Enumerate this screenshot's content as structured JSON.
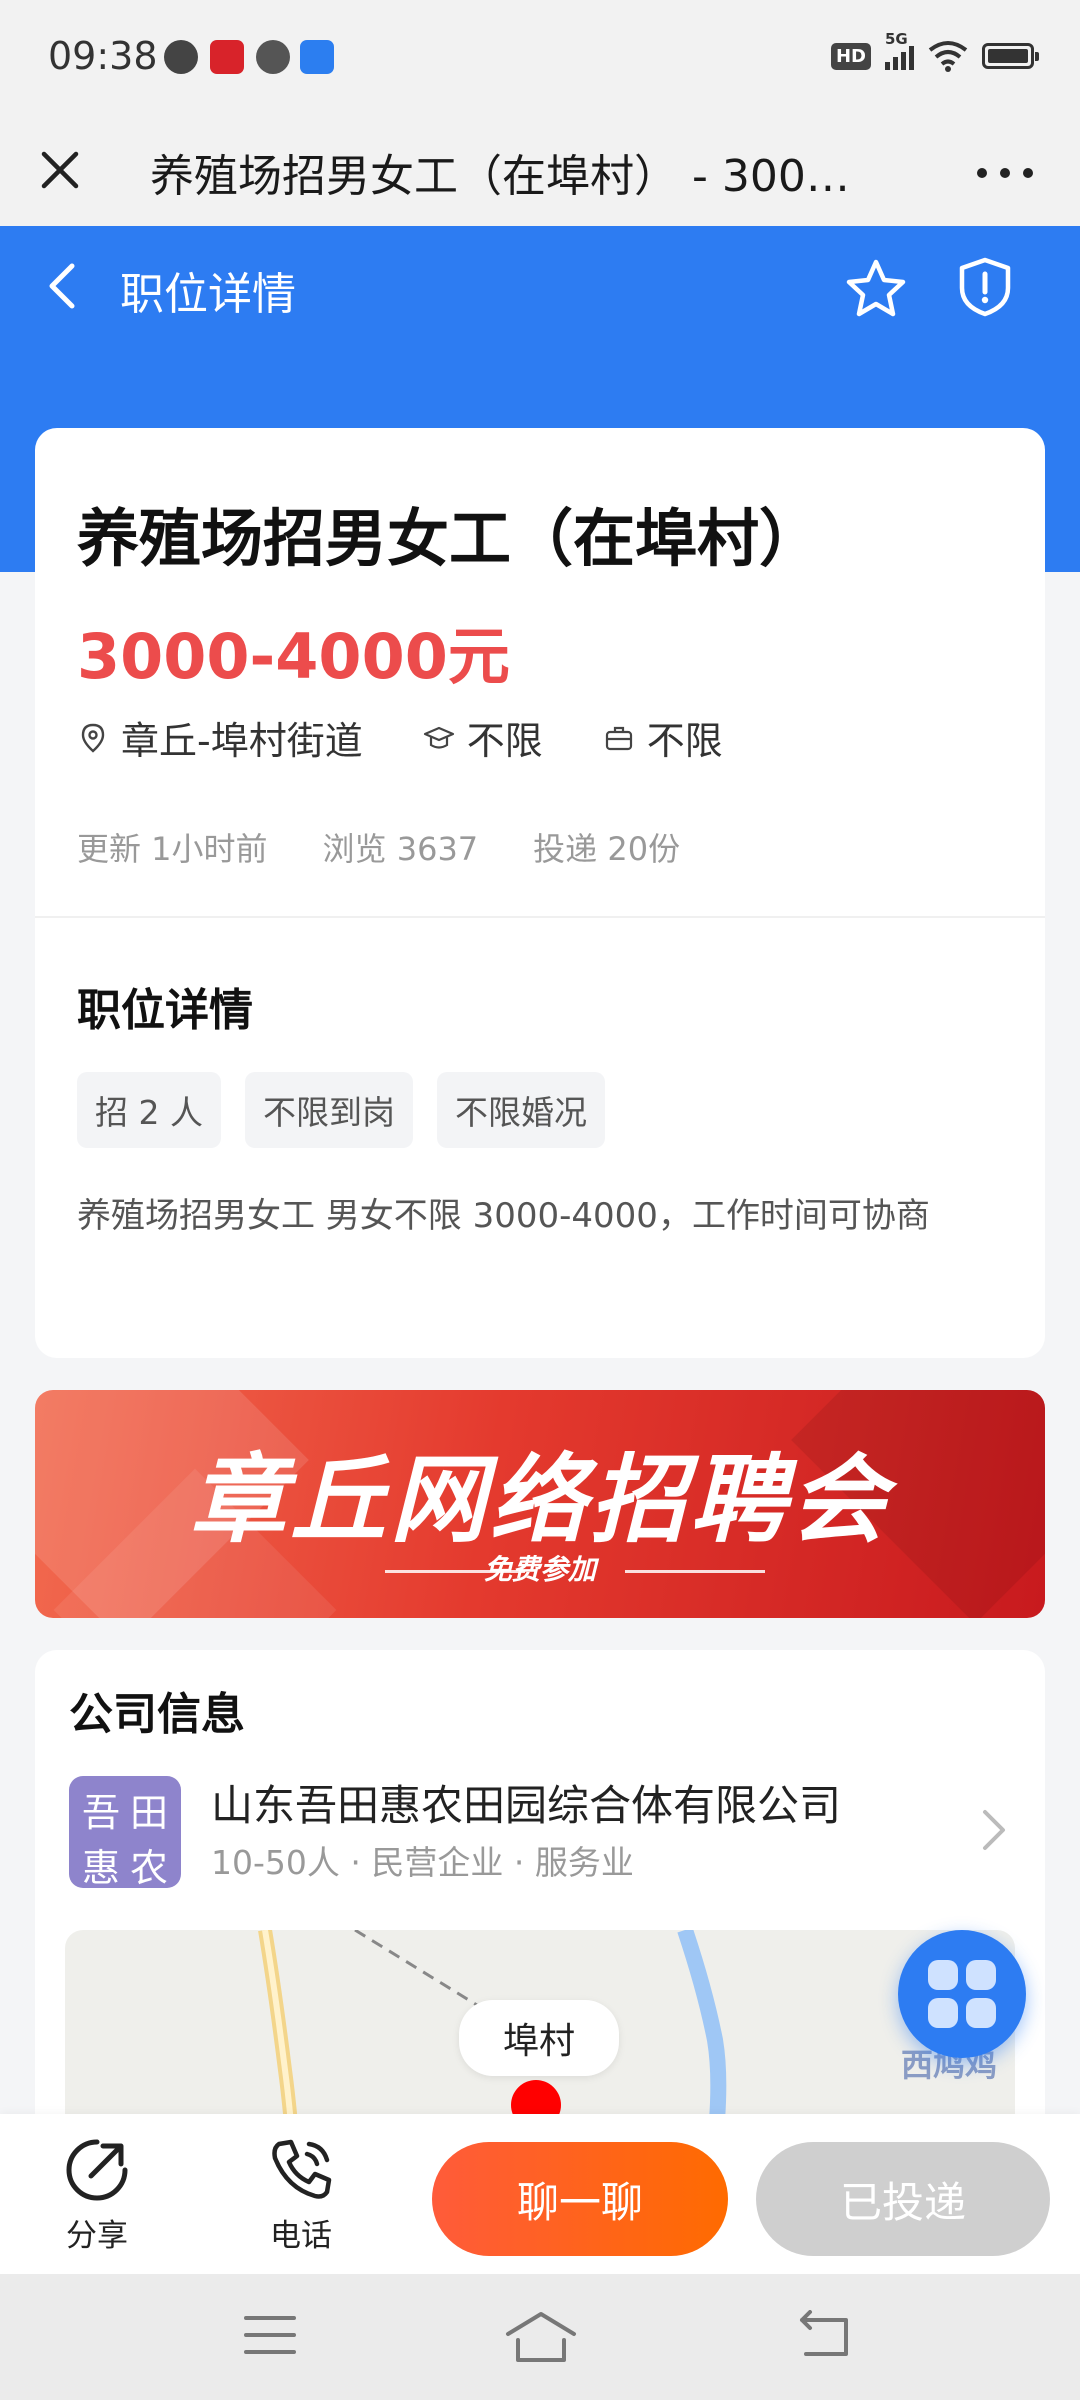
{
  "status_bar": {
    "time": "09:38",
    "network": "5G",
    "hd": "HD"
  },
  "browser": {
    "title": "养殖场招男女工（在埠村） - 300…"
  },
  "nav": {
    "title": "职位详情"
  },
  "job": {
    "title": "养殖场招男女工（在埠村）",
    "salary": "3000-4000元",
    "location": "章丘-埠村街道",
    "education": "不限",
    "experience": "不限",
    "stats": {
      "updated": "更新 1小时前",
      "views": "浏览 3637",
      "applied": "投递 20份"
    },
    "detail_heading": "职位详情",
    "tags": [
      "招 2 人",
      "不限到岗",
      "不限婚况"
    ],
    "description": "养殖场招男女工 男女不限 3000-4000，工作时间可协商"
  },
  "banner": {
    "title": "章丘网络招聘会",
    "subtitle": "免费参加"
  },
  "company": {
    "heading": "公司信息",
    "logo_chars": [
      "吾",
      "田",
      "惠",
      "农"
    ],
    "name": "山东吾田惠农田园综合体有限公司",
    "meta": "10-50人 · 民营企业 · 服务业"
  },
  "map": {
    "label": "埠村",
    "place": "西鸠鸡"
  },
  "actions": {
    "share_label": "分享",
    "phone_label": "电话",
    "chat_label": "聊一聊",
    "applied_label": "已投递"
  },
  "colors": {
    "primary": "#2d7cf2",
    "salary": "#ec4c4c",
    "chat_gradient": [
      "#ff5b3a",
      "#ff6b00"
    ],
    "disabled": "#cfcfcf"
  }
}
